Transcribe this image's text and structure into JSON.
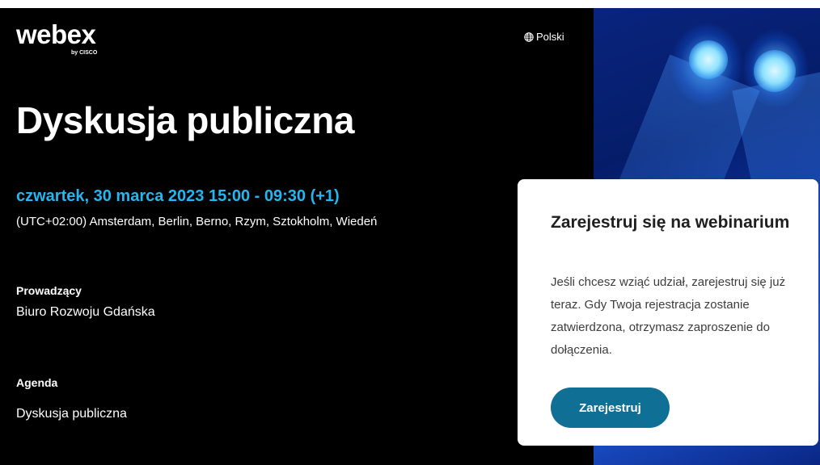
{
  "brand": {
    "logo_text": "webex",
    "logo_sub": "by CISCO"
  },
  "language": {
    "label": "Polski",
    "icon": "globe-icon"
  },
  "event": {
    "title": "Dyskusja publiczna",
    "datetime": "czwartek, 30 marca 2023 15:00 - 09:30 (+1)",
    "timezone": "(UTC+02:00) Amsterdam, Berlin, Berno, Rzym, Sztokholm, Wiedeń",
    "host_label": "Prowadzący",
    "host_name": "Biuro Rozwoju Gdańska",
    "agenda_label": "Agenda",
    "agenda_text": "Dyskusja publiczna"
  },
  "registration_card": {
    "title": "Zarejestruj się na webinarium",
    "description": "Jeśli chcesz wziąć udział, zarejestruj się już teraz. Gdy Twoja rejestracja zostanie zatwierdzona, otrzymasz zaproszenie do dołączenia.",
    "button_label": "Zarejestruj"
  },
  "colors": {
    "background": "#000000",
    "accent_datetime": "#24b6f0",
    "button": "#0f6f94",
    "card": "#ffffff"
  }
}
